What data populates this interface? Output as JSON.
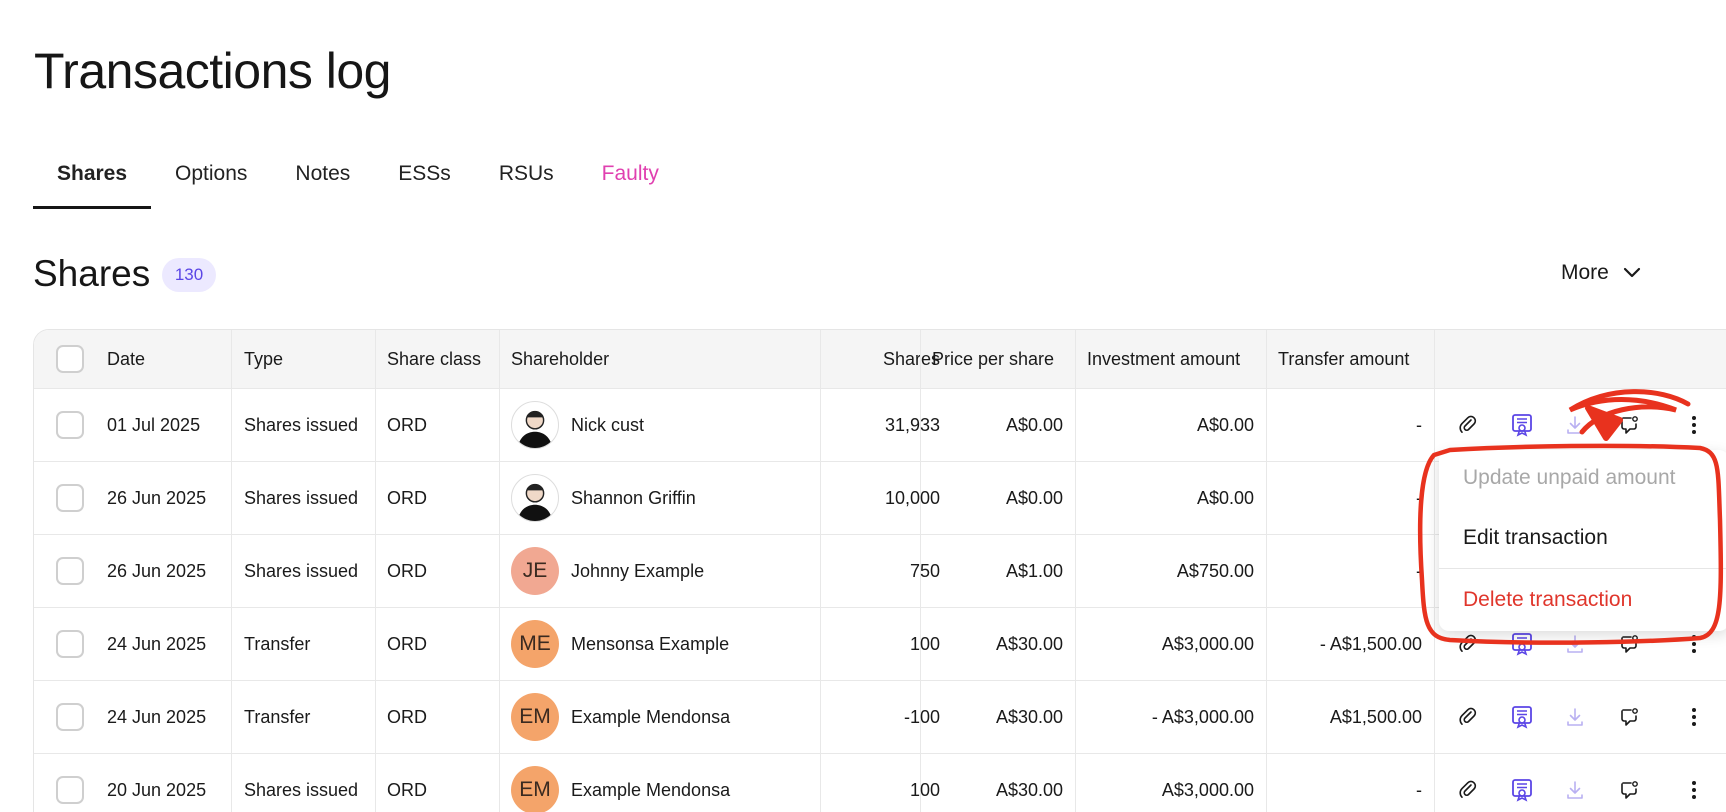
{
  "page_title": "Transactions log",
  "tabs": [
    {
      "label": "Shares"
    },
    {
      "label": "Options"
    },
    {
      "label": "Notes"
    },
    {
      "label": "ESSs"
    },
    {
      "label": "RSUs"
    },
    {
      "label": "Faulty"
    }
  ],
  "section": {
    "title": "Shares",
    "count": "130",
    "more_label": "More"
  },
  "table": {
    "columns": {
      "date": "Date",
      "type": "Type",
      "share_class": "Share class",
      "shareholder": "Shareholder",
      "shares": "Shares",
      "price_per_share": "Price per share",
      "investment_amount": "Investment amount",
      "transfer_amount": "Transfer amount"
    },
    "rows": [
      {
        "date": "01 Jul 2025",
        "type": "Shares issued",
        "share_class": "ORD",
        "avatar": "",
        "shareholder": "Nick cust",
        "shares": "31,933",
        "price": "A$0.00",
        "investment": "A$0.00",
        "transfer": "-"
      },
      {
        "date": "26 Jun 2025",
        "type": "Shares issued",
        "share_class": "ORD",
        "avatar": "",
        "shareholder": "Shannon Griffin",
        "shares": "10,000",
        "price": "A$0.00",
        "investment": "A$0.00",
        "transfer": "-"
      },
      {
        "date": "26 Jun 2025",
        "type": "Shares issued",
        "share_class": "ORD",
        "avatar": "JE",
        "shareholder": "Johnny Example",
        "shares": "750",
        "price": "A$1.00",
        "investment": "A$750.00",
        "transfer": "-"
      },
      {
        "date": "24 Jun 2025",
        "type": "Transfer",
        "share_class": "ORD",
        "avatar": "ME",
        "shareholder": "Mensonsa Example",
        "shares": "100",
        "price": "A$30.00",
        "investment": "A$3,000.00",
        "transfer": "- A$1,500.00"
      },
      {
        "date": "24 Jun 2025",
        "type": "Transfer",
        "share_class": "ORD",
        "avatar": "EM",
        "shareholder": "Example Mendonsa",
        "shares": "-100",
        "price": "A$30.00",
        "investment": "- A$3,000.00",
        "transfer": "A$1,500.00"
      },
      {
        "date": "20 Jun 2025",
        "type": "Shares issued",
        "share_class": "ORD",
        "avatar": "EM",
        "shareholder": "Example Mendonsa",
        "shares": "100",
        "price": "A$30.00",
        "investment": "A$3,000.00",
        "transfer": "-"
      }
    ]
  },
  "menu": {
    "update_unpaid": "Update unpaid amount",
    "edit": "Edit transaction",
    "delete": "Delete transaction"
  },
  "colors": {
    "accent": "#5b46e6",
    "faulty_tab": "#e040b0",
    "delete": "#e0362c",
    "avatar_je": "#f1a892",
    "avatar_me": "#f4a46a",
    "annotation": "#e8321e"
  }
}
